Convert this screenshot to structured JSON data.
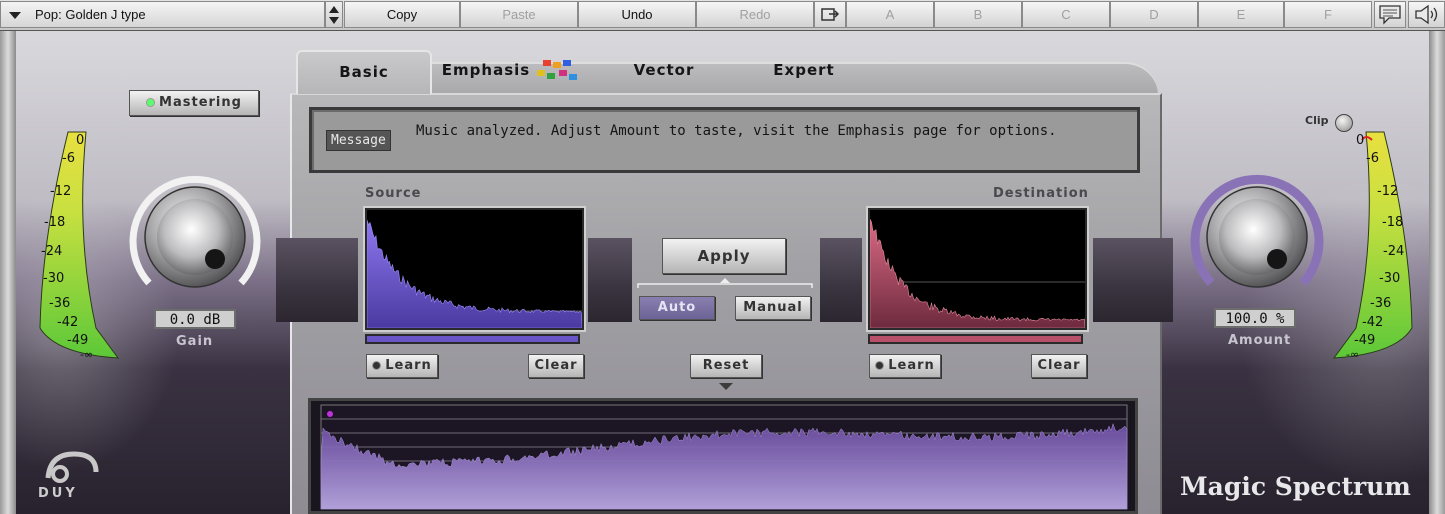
{
  "toolbar": {
    "preset_label": "Pop: Golden J type",
    "copy": "Copy",
    "paste": "Paste",
    "undo": "Undo",
    "redo": "Redo",
    "slots": [
      "A",
      "B",
      "C",
      "D",
      "E",
      "F"
    ],
    "icons": [
      "export-icon",
      "comment-icon",
      "speaker-icon"
    ]
  },
  "tabs": [
    {
      "label": "Basic",
      "active": true
    },
    {
      "label": "Emphasis",
      "active": false
    },
    {
      "label": "Vector",
      "active": false
    },
    {
      "label": "Expert",
      "active": false
    }
  ],
  "message": {
    "label": "Message",
    "text": "Music analyzed. Adjust Amount to taste, visit the Emphasis page for options."
  },
  "source": {
    "label": "Source",
    "learn": "Learn",
    "clear": "Clear"
  },
  "destination": {
    "label": "Destination",
    "learn": "Learn",
    "clear": "Clear"
  },
  "controls": {
    "apply": "Apply",
    "auto": "Auto",
    "manual": "Manual",
    "reset": "Reset",
    "mode": "Auto"
  },
  "left": {
    "mastering": "Mastering",
    "mastering_on": true,
    "gain_value": "0.0 dB",
    "gain_label": "Gain",
    "meter_ticks": [
      "0",
      "-6",
      "-12",
      "-18",
      "-24",
      "-30",
      "-36",
      "-42",
      "-49",
      "-∞"
    ]
  },
  "right": {
    "clip": "Clip",
    "amount_value": "100.0 %",
    "amount_label": "Amount",
    "amount_fraction": 1.0,
    "meter_ticks": [
      "0",
      "-6",
      "-12",
      "-18",
      "-24",
      "-30",
      "-36",
      "-42",
      "-49",
      "-∞"
    ]
  },
  "branding": {
    "product": "Magic Spectrum",
    "company": "DUY"
  },
  "colors": {
    "source_fill": "#6a55c8",
    "destination_fill": "#b8506a",
    "amount_arc": "#8a72b6",
    "meter_green": "#7fd13a",
    "meter_yellow": "#e8e040"
  }
}
